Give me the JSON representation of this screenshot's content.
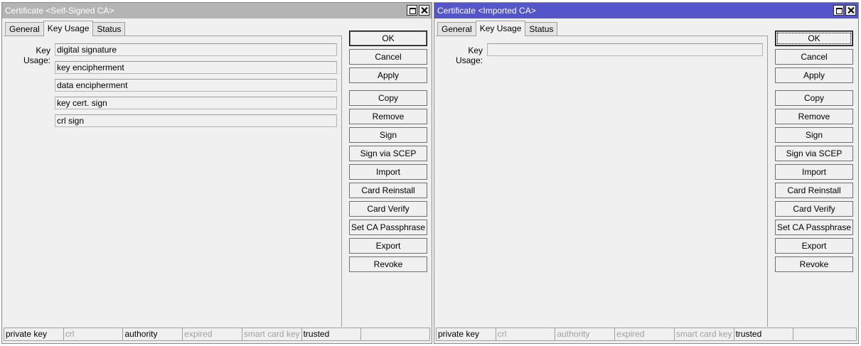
{
  "left_window": {
    "title": "Certificate <Self-Signed CA>",
    "tabs": [
      "General",
      "Key Usage",
      "Status"
    ],
    "active_tab": "Key Usage",
    "key_usage_label": "Key Usage:",
    "key_usage_values": [
      "digital signature",
      "key encipherment",
      "data encipherment",
      "key cert. sign",
      "crl sign"
    ],
    "buttons": [
      "OK",
      "Cancel",
      "Apply",
      "Copy",
      "Remove",
      "Sign",
      "Sign via SCEP",
      "Import",
      "Card Reinstall",
      "Card Verify",
      "Set CA Passphrase",
      "Export",
      "Revoke"
    ],
    "status": [
      {
        "label": "private key",
        "active": true
      },
      {
        "label": "crl",
        "active": false
      },
      {
        "label": "authority",
        "active": true
      },
      {
        "label": "expired",
        "active": false
      },
      {
        "label": "smart card key",
        "active": false
      },
      {
        "label": "trusted",
        "active": true
      },
      {
        "label": "",
        "active": false
      }
    ]
  },
  "right_window": {
    "title": "Certificate <Imported CA>",
    "tabs": [
      "General",
      "Key Usage",
      "Status"
    ],
    "active_tab": "Key Usage",
    "key_usage_label": "Key Usage:",
    "key_usage_values": [
      ""
    ],
    "buttons": [
      "OK",
      "Cancel",
      "Apply",
      "Copy",
      "Remove",
      "Sign",
      "Sign via SCEP",
      "Import",
      "Card Reinstall",
      "Card Verify",
      "Set CA Passphrase",
      "Export",
      "Revoke"
    ],
    "status": [
      {
        "label": "private key",
        "active": true
      },
      {
        "label": "crl",
        "active": false
      },
      {
        "label": "authority",
        "active": false
      },
      {
        "label": "expired",
        "active": false
      },
      {
        "label": "smart card key",
        "active": false
      },
      {
        "label": "trusted",
        "active": true
      },
      {
        "label": "",
        "active": false
      }
    ]
  },
  "colors": {
    "inactive_title": "#b4b4b4",
    "active_title": "#5355c9",
    "window_bg": "#f0f0f0",
    "disabled_text": "#a0a0a0"
  }
}
